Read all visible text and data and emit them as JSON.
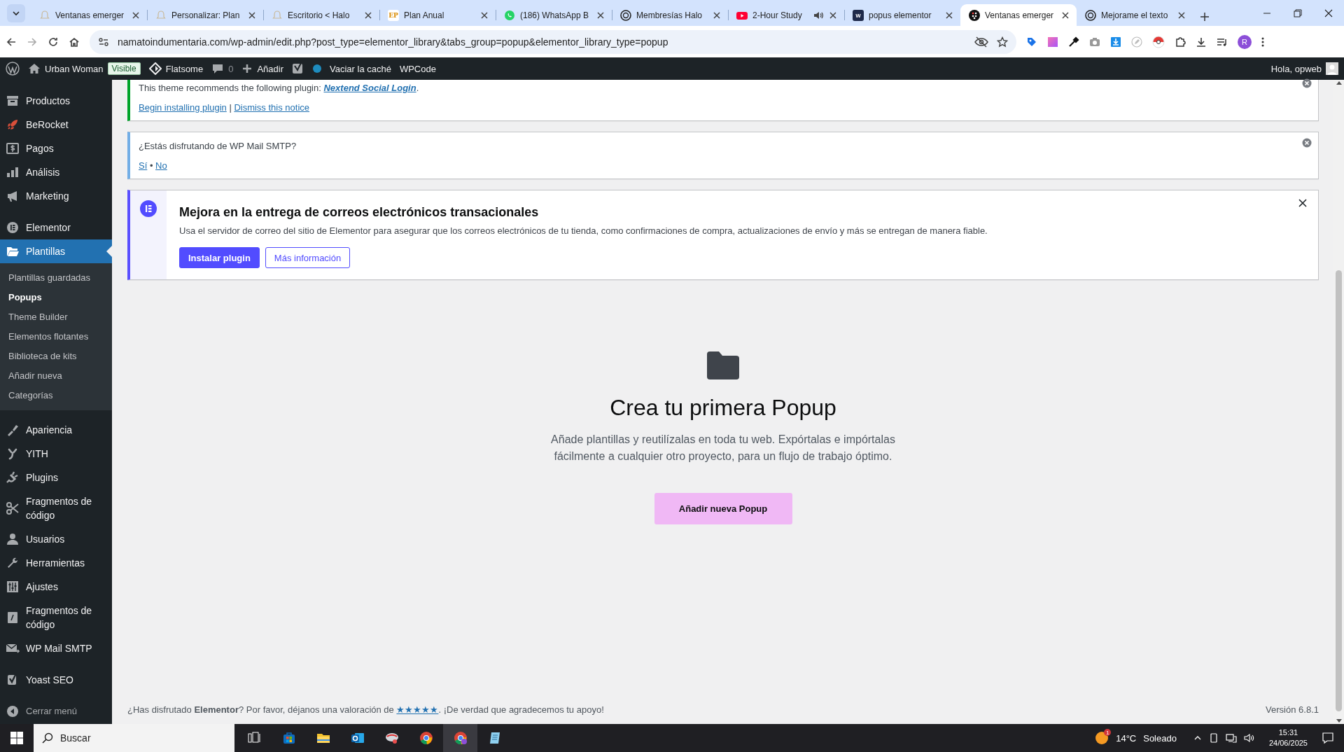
{
  "browser": {
    "tabs": [
      {
        "kind": "bell",
        "title": "Ventanas emerger",
        "selected": false,
        "audio": false
      },
      {
        "kind": "bell",
        "title": "Personalizar: Plan",
        "selected": false,
        "audio": false
      },
      {
        "kind": "bell",
        "title": "Escritorio < Halo",
        "selected": false,
        "audio": false
      },
      {
        "kind": "letters-light",
        "favicon_text": "EP",
        "title": "Plan Anual",
        "selected": false,
        "audio": false
      },
      {
        "kind": "chat",
        "title": "(186) WhatsApp B",
        "selected": false,
        "audio": false
      },
      {
        "kind": "knot",
        "title": "Membresías Halo",
        "selected": false,
        "audio": false
      },
      {
        "kind": "play",
        "title": "2-Hour Study",
        "selected": false,
        "audio": true
      },
      {
        "kind": "letters-dark",
        "favicon_text": "w",
        "title": "popus elementor",
        "selected": false,
        "audio": false
      },
      {
        "kind": "dots",
        "title": "Ventanas emerger",
        "selected": true,
        "audio": false
      },
      {
        "kind": "knot",
        "title": "Mejorame el texto",
        "selected": false,
        "audio": false
      }
    ],
    "url": "namatoindumentaria.com/wp-admin/edit.php?post_type=elementor_library&tabs_group=popup&elementor_library_type=popup",
    "profile": "R"
  },
  "adminbar": {
    "site": "Urban Woman",
    "badge": "Visible",
    "theme": "Flatsome",
    "comments": "0",
    "add": "Añadir",
    "cache": "Vaciar la caché",
    "code": "WPCode",
    "greeting": "Hola, opweb"
  },
  "sidebar": {
    "groups": [
      [
        {
          "kind": "box",
          "label": "Productos",
          "selected": false
        },
        {
          "kind": "rocket",
          "label": "BeRocket",
          "selected": false
        },
        {
          "kind": "dollar",
          "label": "Pagos",
          "selected": false
        },
        {
          "kind": "chart",
          "label": "Análisis",
          "selected": false
        },
        {
          "kind": "megaphone",
          "label": "Marketing",
          "selected": false
        }
      ],
      [
        {
          "kind": "elementor",
          "label": "Elementor",
          "selected": false
        },
        {
          "kind": "folder",
          "label": "Plantillas",
          "selected": true,
          "children": [
            {
              "label": "Plantillas guardadas",
              "selected": false
            },
            {
              "label": "Popups",
              "selected": true
            },
            {
              "label": "Theme Builder",
              "selected": false
            },
            {
              "label": "Elementos flotantes",
              "selected": false
            },
            {
              "label": "Biblioteca de kits",
              "selected": false
            },
            {
              "label": "Añadir nueva",
              "selected": false
            },
            {
              "label": "Categorías",
              "selected": false
            }
          ]
        }
      ],
      [
        {
          "kind": "brush",
          "label": "Apariencia",
          "selected": false
        },
        {
          "kind": "swirl",
          "label": "YITH",
          "selected": false
        },
        {
          "kind": "plug",
          "label": "Plugins",
          "selected": false
        },
        {
          "kind": "scissors",
          "label": "Fragmentos de código",
          "selected": false
        },
        {
          "kind": "user",
          "label": "Usuarios",
          "selected": false
        },
        {
          "kind": "wrench",
          "label": "Herramientas",
          "selected": false
        },
        {
          "kind": "sliders",
          "label": "Ajustes",
          "selected": false
        },
        {
          "kind": "code",
          "label": "Fragmentos de código",
          "selected": false
        },
        {
          "kind": "mail",
          "label": "WP Mail SMTP",
          "selected": false
        }
      ],
      [
        {
          "kind": "check",
          "label": "Yoast SEO",
          "selected": false
        }
      ]
    ],
    "collapse": "Cerrar menú"
  },
  "notices": [
    {
      "kind": "theme",
      "text": "This theme recommends the following plugin: ",
      "link": "Nextend Social Login",
      "after": ".",
      "actions": [
        "Begin installing plugin",
        "Dismiss this notice"
      ],
      "separator": "|"
    },
    {
      "kind": "feedback",
      "text": "¿Estás disfrutando de WP Mail SMTP?",
      "actions": [
        "Sí",
        "No"
      ],
      "separator": "•"
    },
    {
      "kind": "promo",
      "title": "Mejora en la entrega de correos electrónicos transacionales",
      "text": "Usa el servidor de correo del sitio de Elementor para asegurar que los correos electrónicos de tu tienda, como confirmaciones de compra, actualizaciones de envío y más se entregan de manera fiable.",
      "buttons": [
        {
          "label": "Instalar plugin",
          "kind": "primary"
        },
        {
          "label": "Más información",
          "kind": "secondary"
        }
      ]
    }
  ],
  "empty": {
    "title": "Crea tu primera Popup",
    "text": "Añade plantillas y reutilízalas en toda tu web. Expórtalas e impórtalas fácilmente a cualquier otro proyecto, para un flujo de trabajo óptimo.",
    "button": "Añadir nueva Popup"
  },
  "footer": {
    "text": "¿Has disfrutado **Elementor**? Por favor, déjanos una valoración de ",
    "link": "★★★★★",
    "after": ". ¡De verdad que agradecemos tu apoyo!",
    "version": "Versión 6.8.1"
  },
  "taskbar": {
    "search": {
      "placeholder": "Buscar"
    },
    "weather_badge": "1",
    "temperature": "14°C",
    "condition": "Soleado",
    "time": "15:31",
    "date": "24/06/2025"
  }
}
